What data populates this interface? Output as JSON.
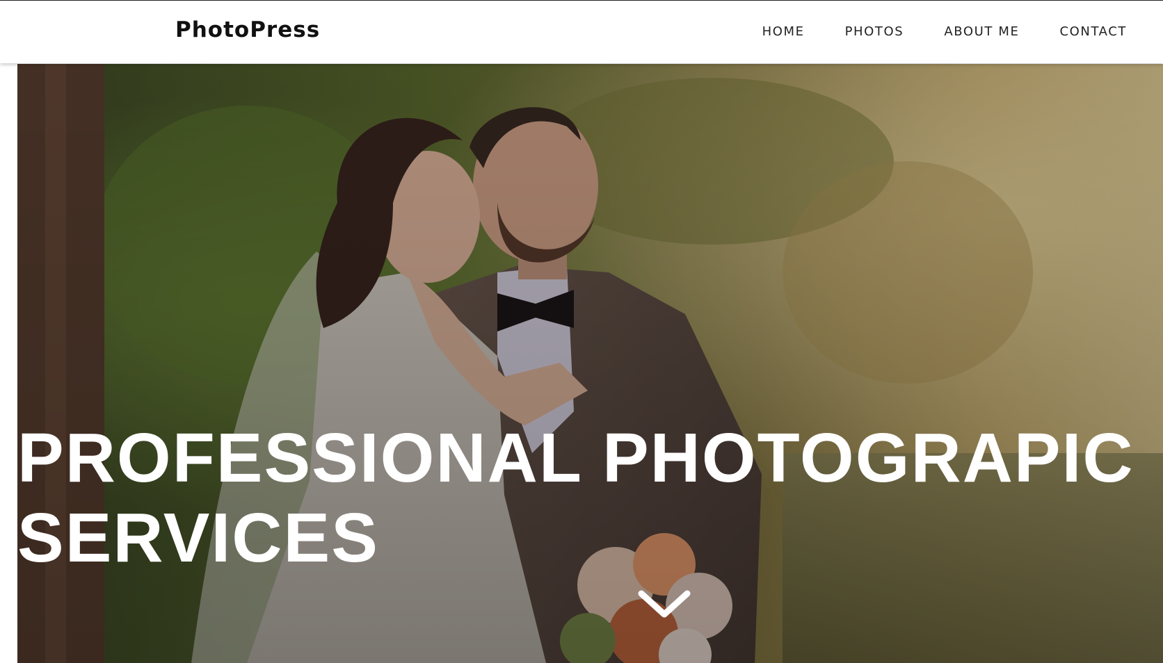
{
  "brand": "PhotoPress",
  "nav": {
    "items": [
      "HOME",
      "PHOTOS",
      "ABOUT ME",
      "CONTACT"
    ]
  },
  "hero": {
    "title_line1": "PROFESSIONAL PHOTOGRAPIC",
    "title_line2": "SERVICES",
    "image": "wedding-couple-photo",
    "scroll_icon": "chevron-down-icon"
  },
  "colors": {
    "navbar_bg": "#ffffff",
    "text_dark": "#111111",
    "hero_text": "#ffffff"
  }
}
